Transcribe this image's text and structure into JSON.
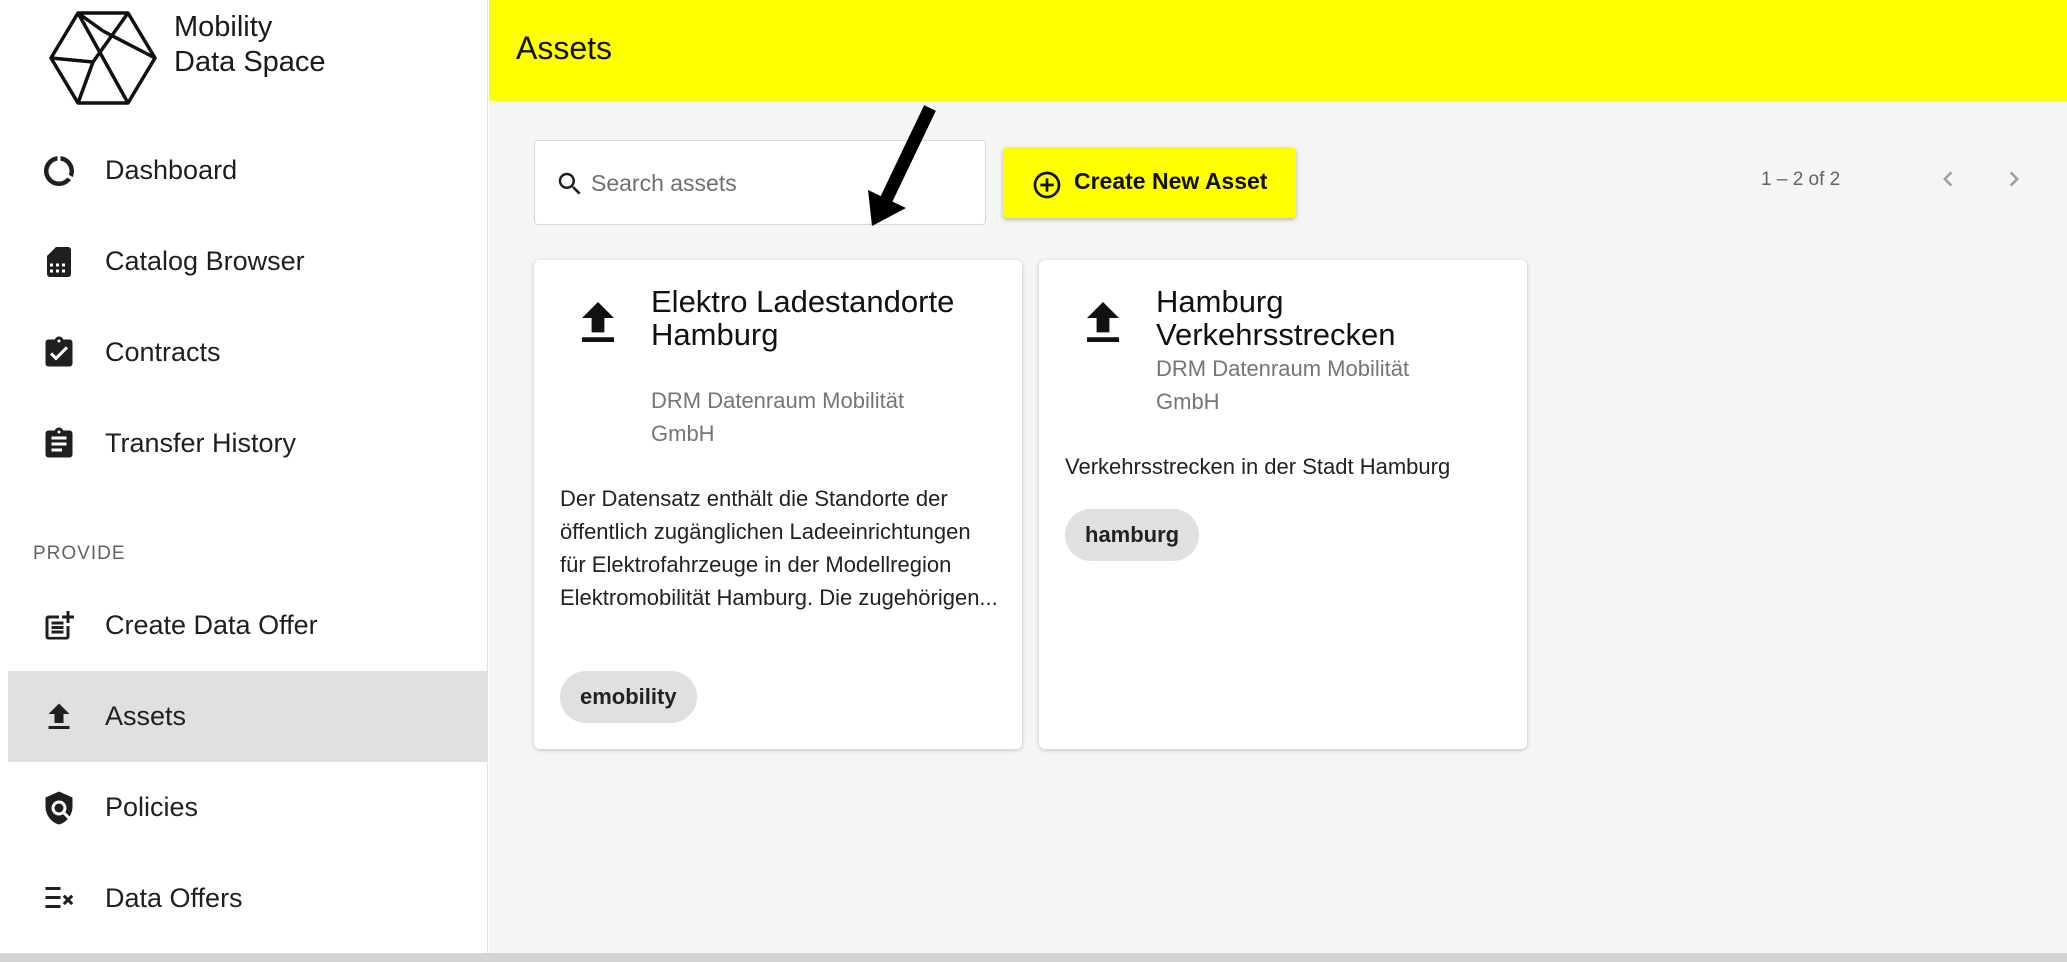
{
  "logo": {
    "line1": "Mobility",
    "line2": "Data Space"
  },
  "sidebar": {
    "items": [
      {
        "label": "Dashboard",
        "icon": "dashboard-donut-icon"
      },
      {
        "label": "Catalog Browser",
        "icon": "catalog-card-icon"
      },
      {
        "label": "Contracts",
        "icon": "clipboard-check-icon"
      },
      {
        "label": "Transfer History",
        "icon": "clipboard-list-icon"
      }
    ],
    "section": "PROVIDE",
    "provide_items": [
      {
        "label": "Create Data Offer",
        "icon": "post-add-icon"
      },
      {
        "label": "Assets",
        "icon": "upload-icon",
        "active": true
      },
      {
        "label": "Policies",
        "icon": "policy-shield-icon"
      },
      {
        "label": "Data Offers",
        "icon": "rule-checklist-icon"
      }
    ]
  },
  "header": {
    "title": "Assets"
  },
  "toolbar": {
    "search_placeholder": "Search assets",
    "create_label": "Create New Asset"
  },
  "pagination": {
    "text": "1 – 2 of 2"
  },
  "assets": [
    {
      "title": "Elektro Ladestandorte Hamburg",
      "publisher": "DRM Datenraum Mobilität GmbH",
      "description": "Der Datensatz enthält die Standorte der öffentlich zugänglichen Ladeeinrichtungen für Elektrofahrzeuge in der Modellregion Elektromobilität Hamburg. Die zugehörigen...",
      "keyword": "emobility"
    },
    {
      "title": "Hamburg Verkehrsstrecken",
      "publisher": "DRM Datenraum Mobilität GmbH",
      "description": "Verkehrsstrecken in der Stadt Hamburg",
      "keyword": "hamburg"
    }
  ],
  "colors": {
    "accent": "#ffff00",
    "active_nav": "#e0e0e0",
    "background": "#f5f5f5"
  }
}
